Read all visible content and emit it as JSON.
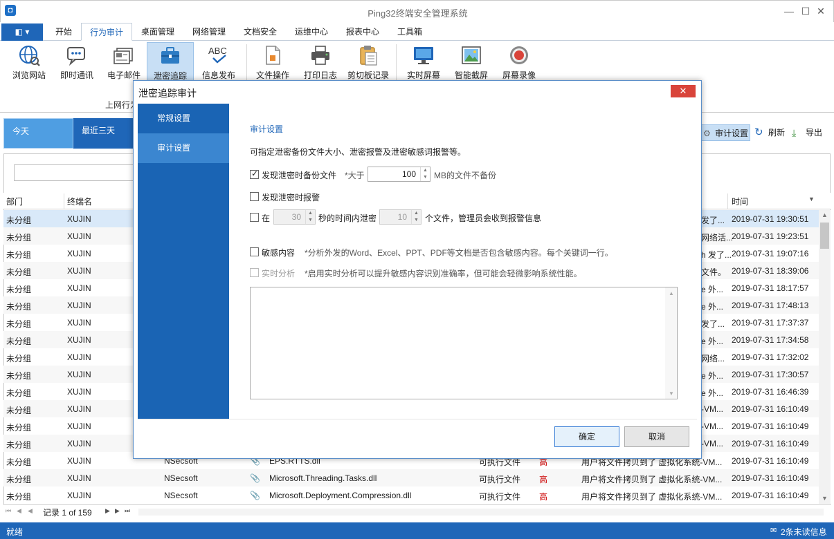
{
  "window": {
    "title": "Ping32终端安全管理系统",
    "minimize": "—",
    "maximize": "☐",
    "close": "✕"
  },
  "menu": {
    "file_icon": "◧ ▾",
    "tabs": [
      "开始",
      "行为审计",
      "桌面管理",
      "网络管理",
      "文档安全",
      "运维中心",
      "报表中心",
      "工具箱"
    ],
    "active_tab": "行为审计"
  },
  "ribbon": {
    "buttons": [
      {
        "label": "浏览网站",
        "icon": "globe-icon"
      },
      {
        "label": "即时通讯",
        "icon": "chat-icon"
      },
      {
        "label": "电子邮件",
        "icon": "mail-icon"
      },
      {
        "label": "泄密追踪",
        "icon": "briefcase-icon"
      },
      {
        "label": "信息发布",
        "icon": "abc-icon"
      },
      {
        "label": "文件操作",
        "icon": "file-icon"
      },
      {
        "label": "打印日志",
        "icon": "printer-icon"
      },
      {
        "label": "剪切板记录",
        "icon": "clipboard-icon"
      },
      {
        "label": "实时屏幕",
        "icon": "monitor-icon"
      },
      {
        "label": "智能截屏",
        "icon": "picture-icon"
      },
      {
        "label": "屏幕录像",
        "icon": "record-icon"
      }
    ],
    "active": "泄密追踪",
    "group_label": "上网行为"
  },
  "date_tabs": [
    "今天",
    "最近三天"
  ],
  "toolbar": {
    "settings": "审计设置",
    "refresh": "刷新",
    "export": "导出"
  },
  "grid": {
    "headers": {
      "dept": "部门",
      "terminal": "终端名",
      "time": "时间"
    },
    "rows": [
      {
        "dept": "未分组",
        "terminal": "XUJIN",
        "tail": "发了...",
        "time": "2019-07-31 19:30:51"
      },
      {
        "dept": "未分组",
        "terminal": "XUJIN",
        "tail": "网络活...",
        "time": "2019-07-31 19:23:51"
      },
      {
        "dept": "未分组",
        "terminal": "XUJIN",
        "tail": "h 发了...",
        "time": "2019-07-31 19:07:16"
      },
      {
        "dept": "未分组",
        "terminal": "XUJIN",
        "tail": "文件。",
        "time": "2019-07-31 18:39:06"
      },
      {
        "dept": "未分组",
        "terminal": "XUJIN",
        "tail": "e 外...",
        "time": "2019-07-31 18:17:57"
      },
      {
        "dept": "未分组",
        "terminal": "XUJIN",
        "tail": "e 外...",
        "time": "2019-07-31 17:48:13"
      },
      {
        "dept": "未分组",
        "terminal": "XUJIN",
        "tail": "发了...",
        "time": "2019-07-31 17:37:37"
      },
      {
        "dept": "未分组",
        "terminal": "XUJIN",
        "tail": "e 外...",
        "time": "2019-07-31 17:34:58"
      },
      {
        "dept": "未分组",
        "terminal": "XUJIN",
        "tail": "网络...",
        "time": "2019-07-31 17:32:02"
      },
      {
        "dept": "未分组",
        "terminal": "XUJIN",
        "tail": "e 外...",
        "time": "2019-07-31 17:30:57"
      },
      {
        "dept": "未分组",
        "terminal": "XUJIN",
        "tail": "e 外...",
        "time": "2019-07-31 16:46:39"
      },
      {
        "dept": "未分组",
        "terminal": "XUJIN",
        "tail": "-VM...",
        "time": "2019-07-31 16:10:49"
      },
      {
        "dept": "未分组",
        "terminal": "XUJIN",
        "tail": "-VM...",
        "time": "2019-07-31 16:10:49"
      },
      {
        "dept": "未分组",
        "terminal": "XUJIN",
        "tail": "-VM...",
        "time": "2019-07-31 16:10:49"
      },
      {
        "dept": "未分组",
        "terminal": "XUJIN",
        "tail": "用户将文件拷贝到了 虚拟化系统-VM...",
        "time": "2019-07-31 16:10:49",
        "process": "NSecsoft",
        "file": "EPS.RTTS.dll",
        "ftype": "可执行文件",
        "level": "高"
      },
      {
        "dept": "未分组",
        "terminal": "XUJIN",
        "tail": "用户将文件拷贝到了 虚拟化系统-VM...",
        "time": "2019-07-31 16:10:49",
        "process": "NSecsoft",
        "file": "Microsoft.Threading.Tasks.dll",
        "ftype": "可执行文件",
        "level": "高"
      },
      {
        "dept": "未分组",
        "terminal": "XUJIN",
        "tail": "用户将文件拷贝到了 虚拟化系统-VM...",
        "time": "2019-07-31 16:10:49",
        "process": "NSecsoft",
        "file": "Microsoft.Deployment.Compression.dll",
        "ftype": "可执行文件",
        "level": "高"
      }
    ]
  },
  "pager": {
    "nav_first": "⏮",
    "nav_prev": "◀",
    "text": "记录 1 of 159",
    "nav_next": "▶",
    "nav_last": "⏭"
  },
  "status": {
    "left": "就绪",
    "right": "2条未读信息"
  },
  "dialog": {
    "title": "泄密追踪审计",
    "close": "✕",
    "side_items": [
      "常规设置",
      "审计设置"
    ],
    "active_side": "审计设置",
    "section_title": "审计设置",
    "description": "可指定泄密备份文件大小、泄密报警及泄密敏感词报警等。",
    "backup": {
      "checked": true,
      "label": "发现泄密时备份文件",
      "prefix": "*大于",
      "value": "100",
      "suffix": "MB的文件不备份"
    },
    "alarm": {
      "checked": false,
      "label": "发现泄密时报警"
    },
    "threshold": {
      "checked": false,
      "prefix": "在",
      "seconds": "30",
      "middle": "秒的时间内泄密",
      "count": "10",
      "suffix": "个文件，管理员会收到报警信息"
    },
    "sensitive": {
      "checked": false,
      "label": "敏感内容",
      "hint": "*分析外发的Word、Excel、PPT、PDF等文档是否包含敏感内容。每个关键词一行。"
    },
    "realtime": {
      "checked": false,
      "label": "实时分析",
      "hint": "*启用实时分析可以提升敏感内容识别准确率，但可能会轻微影响系统性能。"
    },
    "ok": "确定",
    "cancel": "取消"
  },
  "colors": {
    "accent": "#1f66b8",
    "side": "#1a64b4",
    "side_active": "#3b86d0",
    "close_red": "#d9443a"
  }
}
